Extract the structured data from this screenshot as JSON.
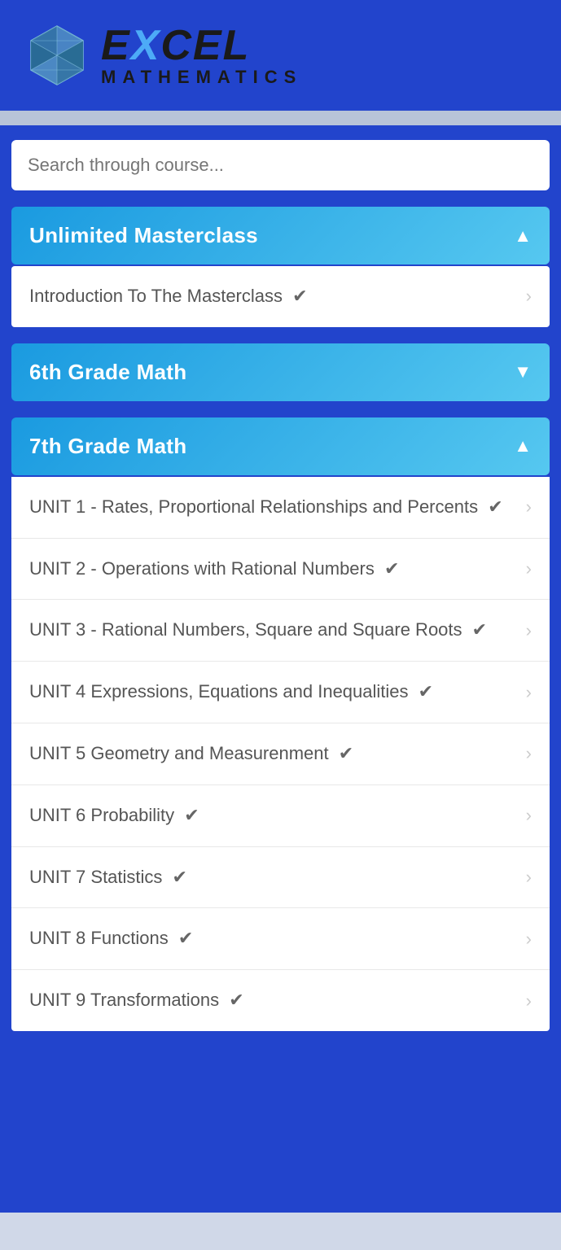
{
  "header": {
    "logo_excel": "EXCEL",
    "logo_excel_highlight": "X",
    "logo_math": "MATHEMATICS"
  },
  "search": {
    "placeholder": "Search through course..."
  },
  "sections": [
    {
      "id": "unlimited-masterclass",
      "label": "Unlimited Masterclass",
      "expanded": true,
      "chevron": "▲",
      "items": [
        {
          "label": "Introduction To The Masterclass",
          "completed": true
        }
      ]
    },
    {
      "id": "6th-grade-math",
      "label": "6th Grade Math",
      "expanded": false,
      "chevron": "▼",
      "items": []
    },
    {
      "id": "7th-grade-math",
      "label": "7th Grade Math",
      "expanded": true,
      "chevron": "▲",
      "items": [
        {
          "label": "UNIT 1 - Rates, Proportional Relationships and Percents",
          "completed": true
        },
        {
          "label": "UNIT 2 - Operations with Rational Numbers",
          "completed": true
        },
        {
          "label": "UNIT 3 - Rational Numbers, Square and Square Roots",
          "completed": true
        },
        {
          "label": "UNIT 4 Expressions, Equations and Inequalities",
          "completed": true
        },
        {
          "label": "UNIT 5 Geometry and Measurenment",
          "completed": true
        },
        {
          "label": "UNIT 6 Probability",
          "completed": true
        },
        {
          "label": "UNIT 7 Statistics",
          "completed": true
        },
        {
          "label": "UNIT 8 Functions",
          "completed": true
        },
        {
          "label": "UNIT 9 Transformations",
          "completed": true
        }
      ]
    }
  ],
  "icons": {
    "check": "✔",
    "chevron_right": "›",
    "chevron_up": "▲",
    "chevron_down": "▼"
  }
}
